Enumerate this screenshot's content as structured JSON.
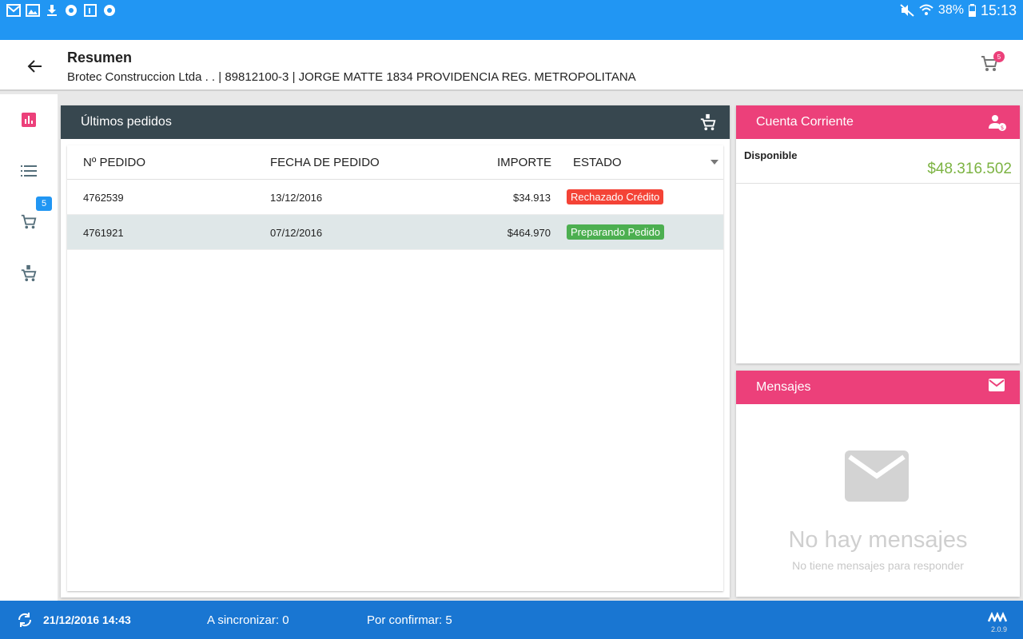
{
  "statusbar": {
    "battery": "38%",
    "time": "15:13"
  },
  "appbar": {
    "title": "Resumen",
    "subtitle": "Brotec Construccion Ltda . .  | 89812100-3 | JORGE MATTE 1834  PROVIDENCIA  REG. METROPOLITANA",
    "cart_count": "5"
  },
  "sidenav": {
    "cart_count": "5"
  },
  "orders": {
    "title": "Últimos pedidos",
    "columns": [
      "Nº PEDIDO",
      "FECHA DE PEDIDO",
      "IMPORTE",
      "ESTADO"
    ],
    "rows": [
      {
        "id": "4762539",
        "date": "13/12/2016",
        "amount": "$34.913",
        "status": "Rechazado Crédito",
        "status_color": "#f44336"
      },
      {
        "id": "4761921",
        "date": "07/12/2016",
        "amount": "$464.970",
        "status": "Preparando Pedido",
        "status_color": "#4caf50"
      }
    ]
  },
  "account": {
    "title": "Cuenta Corriente",
    "label": "Disponible",
    "value": "$48.316.502"
  },
  "messages": {
    "title": "Mensajes",
    "empty_title": "No hay mensajes",
    "empty_sub": "No tiene mensajes para responder"
  },
  "bottombar": {
    "datetime": "21/12/2016 14:43",
    "to_sync": "A sincronizar: 0",
    "to_confirm": "Por confirmar: 5",
    "version": "2.0.9"
  },
  "colors": {
    "primary": "#2196f3",
    "dark": "#37474f",
    "accent": "#ec407a",
    "success": "#4caf50",
    "danger": "#f44336",
    "money": "#7cb342"
  }
}
